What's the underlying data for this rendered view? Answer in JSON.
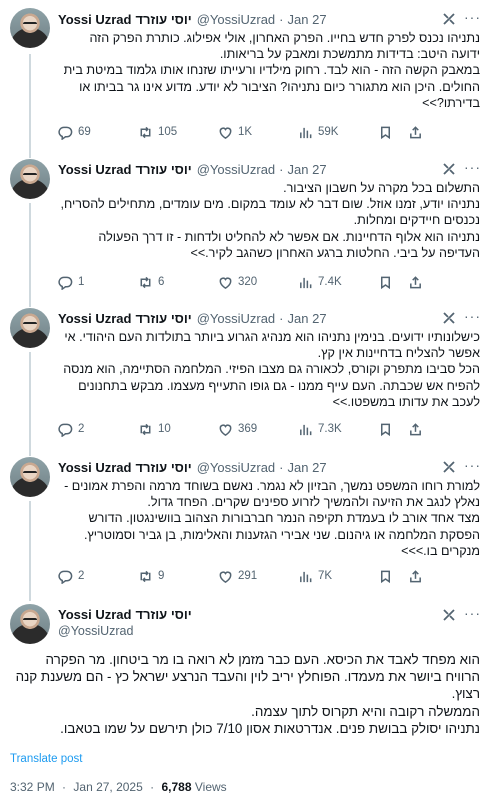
{
  "author": {
    "name": "Yossi Uzrad",
    "name_rtl": "יוסי עוזרד",
    "handle": "@YossiUzrad"
  },
  "separator": "·",
  "tweets": [
    {
      "date": "Jan 27",
      "paragraphs": [
        "נתניהו נכנס לפרק חדש בחייו. הפרק האחרון, אולי אפילוג. כותרת הפרק הזה ידועה היטב: בדידות מתמשכת ומאבק על בריאותו.",
        "במאבק הקשה הזה - הוא לבד. רחוק מילדיו ורעייתו שזנחו אותו גלמוד במיטת בית החולים. היכן הוא מתגורר כיום נתניהו? הציבור לא יודע. מדוע אינו גר בביתו או בדירתו?>>"
      ],
      "replies": "69",
      "retweets": "105",
      "likes": "1K",
      "views": "59K"
    },
    {
      "date": "Jan 27",
      "paragraphs": [
        "התשלום בכל מקרה על חשבון הציבור.",
        "נתניהו יודע, זמנו אוזל. שום דבר לא עומד במקום. מים עומדים, מתחילים להסריח, נכנסים חיידקים ומחלות.",
        "נתניהו הוא אלוף הדחיינות. אם אפשר לא להחליט ולדחות - זו דרך הפעולה העדיפה על ביבי. החלטות ברגע האחרון כשהגב לקיר.>>"
      ],
      "replies": "1",
      "retweets": "6",
      "likes": "320",
      "views": "7.4K"
    },
    {
      "date": "Jan 27",
      "paragraphs": [
        "כישלונותיו ידועים. בנימין נתניהו הוא מנהיג הגרוע ביותר בתולדות העם היהודי. אי אפשר להצליח בדחיינות אין קץ.",
        "הכל סביבו מתפרק וקורס, לכאורה גם מצבו הפיזי. המלחמה הסתיימה, הוא מנסה להפיח אש שכבתה. העם עייף ממנו - גם גופו התעייף מעצמו. מבקש בתחנונים לעכב את עדותו במשפטו.>>"
      ],
      "replies": "2",
      "retweets": "10",
      "likes": "369",
      "views": "7.3K"
    },
    {
      "date": "Jan 27",
      "paragraphs": [
        "למורת רוחו המשפט נמשך, הבזיון לא נגמר. נאשם בשוחד מרמה והפרת אמונים - נאלץ לנגב את הזיעה ולהמשיך לזרוע ספינים שקרים. הפחד גדול.",
        "מצד אחד אורב לו בעמדת תקיפה הנמר חברבורות הצהוב בוושינגטון. הדורש הפסקת המלחמה או גיהנום. שני אבירי הגזענות והאלימות, בן גביר וסמוטריץ. מנקרים בו.>>>"
      ],
      "replies": "2",
      "retweets": "9",
      "likes": "291",
      "views": "7K"
    }
  ],
  "main_tweet": {
    "paragraphs": [
      "הוא מפחד לאבד את הכיסא. העם כבר מזמן לא רואה בו מר ביטחון. מר הפקרה הרוויח ביושר את מעמדו. הפוחלץ יריב לוין והעבד הנרצע ישראל כץ - הם משענת קנה רצוץ.",
      "הממשלה רקובה והיא תקרוס לתוך עצמה.",
      "נתניהו יסולק בבושת פנים. אנדרטאות אסון 7/10 כולן תירשם על שמו בטאבו."
    ],
    "translate_label": "Translate post",
    "time": "3:32 PM",
    "date": "Jan 27, 2025",
    "views_count": "6,788",
    "views_label": "Views"
  },
  "colors": {
    "text": "#0f1419",
    "secondary": "#536471",
    "link": "#1d9bf0",
    "thread_line": "#cfd9de"
  },
  "icons": [
    "grok-icon",
    "more-icon",
    "reply-icon",
    "retweet-icon",
    "like-icon",
    "views-icon",
    "bookmark-icon",
    "share-icon"
  ]
}
